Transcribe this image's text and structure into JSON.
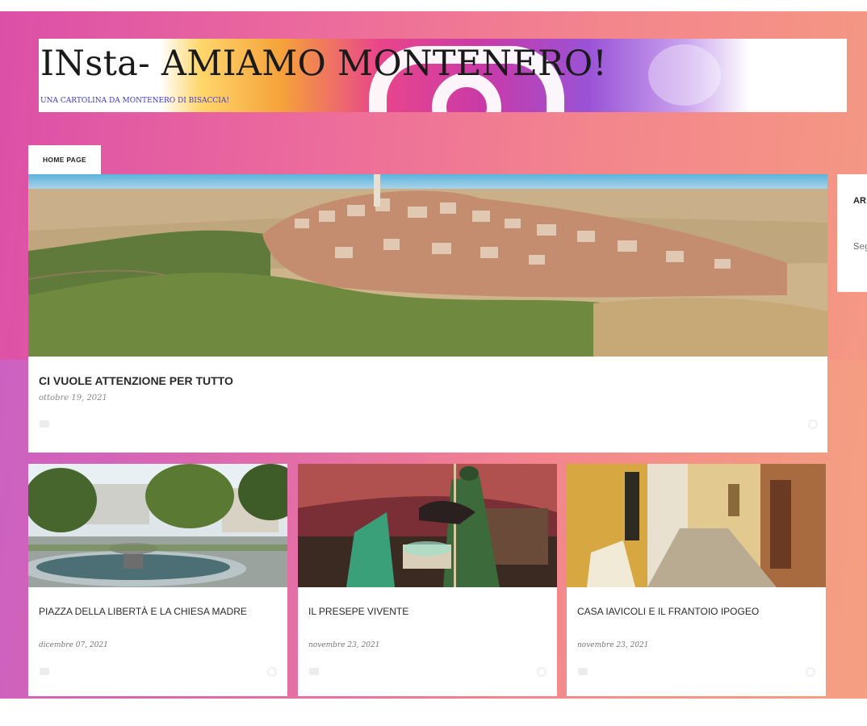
{
  "blog": {
    "title": "INsta- AMIAMO MONTENERO!",
    "description": "UNA CARTOLINA DA MONTENERO DI BISACCIA!"
  },
  "nav": {
    "tabs": [
      {
        "label": "HOME PAGE",
        "active": true
      }
    ]
  },
  "featured_post": {
    "title": "CI VUOLE ATTENZIONE PER TUTTO",
    "date": "ottobre 19, 2021",
    "image": "hilltop-town-panorama",
    "comment_icon": "comment-icon",
    "share_icon": "share-icon"
  },
  "sidebar": {
    "heading": "AR",
    "text": "Seg"
  },
  "posts": [
    {
      "title": "PIAZZA DELLA LIBERTÀ E LA CHIESA MADRE",
      "date": "dicembre 07, 2021",
      "image": "fountain-square"
    },
    {
      "title": "IL PRESEPE VIVENTE",
      "date": "novembre 23, 2021",
      "image": "nativity-scene"
    },
    {
      "title": "CASA IAVICOLI E IL FRANTOIO IPOGEO",
      "date": "novembre 23, 2021",
      "image": "narrow-street"
    }
  ],
  "colors": {
    "background_start": "#dc4fa8",
    "background_end": "#f59a82",
    "card": "#ffffff",
    "description_text": "#3a3ad0"
  }
}
